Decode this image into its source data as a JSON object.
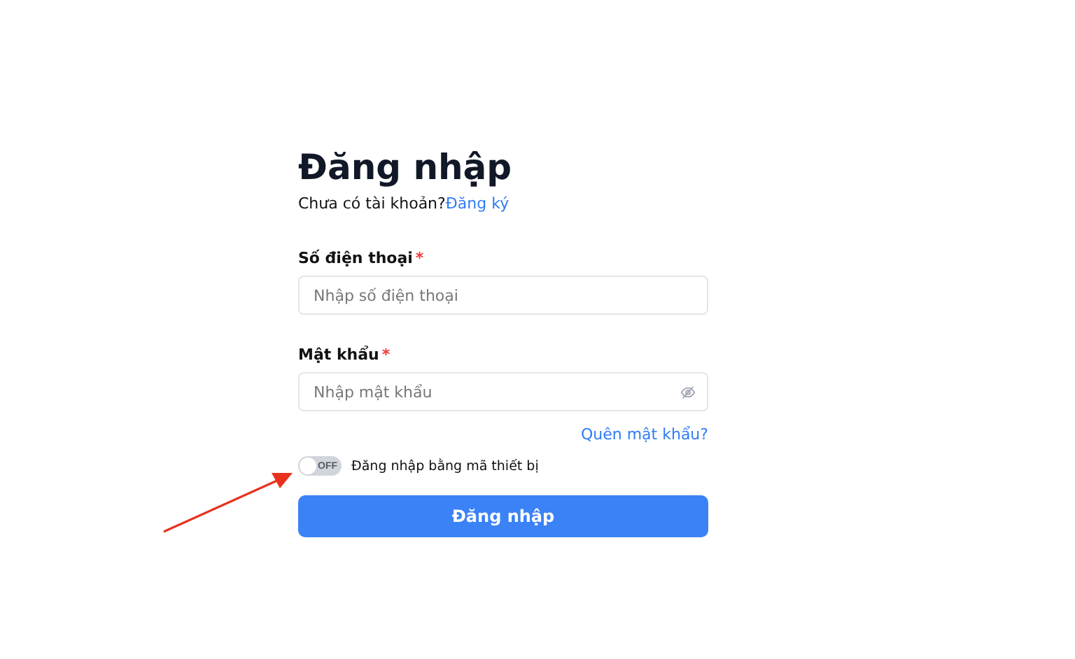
{
  "title": "Đăng nhập",
  "signup_prompt": {
    "text": "Chưa có tài khoản?",
    "link": "Đăng ký"
  },
  "fields": [
    {
      "label": "Số điện thoại",
      "required": true,
      "placeholder": "Nhập số điện thoại",
      "kind": "text"
    },
    {
      "label": "Mật khẩu",
      "required": true,
      "placeholder": "Nhập mật khẩu",
      "kind": "password"
    }
  ],
  "required_mark": "*",
  "forgot_link": "Quên mật khẩu?",
  "device_login": {
    "on": false,
    "switch_text": "OFF",
    "label": "Đăng nhập bằng mã thiết bị"
  },
  "submit_button": "Đăng nhập"
}
